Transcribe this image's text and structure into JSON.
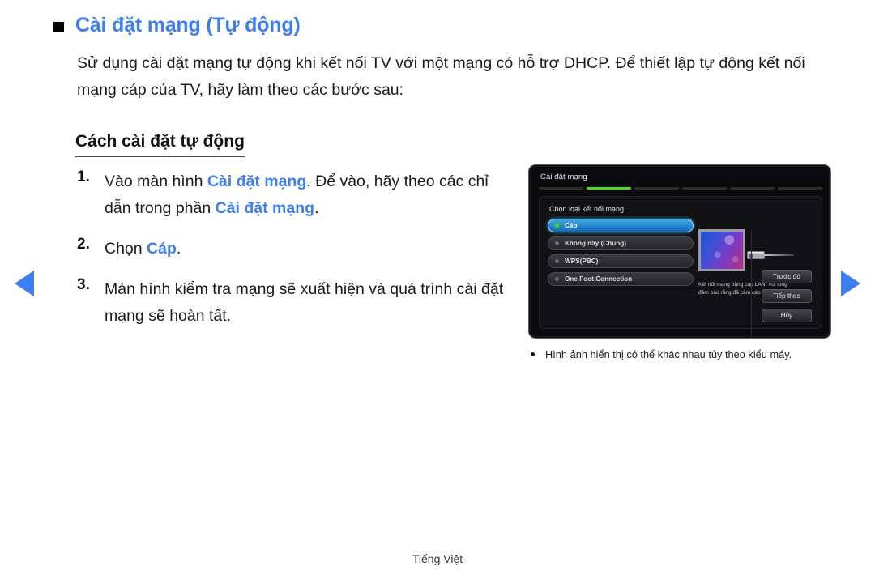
{
  "page": {
    "heading": "Cài đặt mạng (Tự động)",
    "heading_color": "#3d7ff0",
    "intro": "Sử dụng cài đặt mạng tự động khi kết nối TV với một mạng có hỗ trợ DHCP. Để thiết lập tự động kết nối mạng cáp của TV, hãy làm theo các bước sau:",
    "subheading": "Cách cài đặt tự động",
    "footer_language": "Tiếng Việt"
  },
  "nav": {
    "prev_label": "previous-page-arrow",
    "next_label": "next-page-arrow"
  },
  "steps": [
    {
      "number": "1.",
      "parts": [
        {
          "text": "Vào màn hình ",
          "highlight": false
        },
        {
          "text": "Cài đặt mạng",
          "highlight": true
        },
        {
          "text": ". Để vào, hãy theo các chỉ dẫn trong phần ",
          "highlight": false
        },
        {
          "text": "Cài đặt mạng",
          "highlight": true
        },
        {
          "text": ".",
          "highlight": false
        }
      ]
    },
    {
      "number": "2.",
      "parts": [
        {
          "text": "Chọn ",
          "highlight": false
        },
        {
          "text": "Cáp",
          "highlight": true
        },
        {
          "text": ".",
          "highlight": false
        }
      ]
    },
    {
      "number": "3.",
      "parts": [
        {
          "text": "Màn hình kiểm tra mạng sẽ xuất hiện và quá trình cài đặt mạng sẽ hoàn tất.",
          "highlight": false
        }
      ]
    }
  ],
  "tv_screen": {
    "title": "Cài đặt mạng",
    "progress": {
      "total_segments": 6,
      "active_index": 1,
      "active_color": "#4cdb1f"
    },
    "prompt": "Chọn loại kết nối mạng.",
    "options": [
      {
        "label": "Cáp",
        "selected": true,
        "indicator_color": "#35e025"
      },
      {
        "label": "Không dây (Chung)",
        "selected": false,
        "indicator_color": "#6a6c74"
      },
      {
        "label": "WPS(PBC)",
        "selected": false,
        "indicator_color": "#6a6c74"
      },
      {
        "label": "One Foot Connection",
        "selected": false,
        "indicator_color": "#6a6c74"
      }
    ],
    "description": "Kết nối mạng bằng cáp LAN. Vui lòng đảm bảo rằng đã cắm cáp LAN.",
    "actions": [
      {
        "label": "Trước đó"
      },
      {
        "label": "Tiếp theo"
      },
      {
        "label": "Hủy"
      }
    ],
    "illustration": "tv-with-lan-cable-illustration"
  },
  "caption": {
    "note": "Hình ảnh hiển thị có thể khác nhau tùy theo kiểu máy."
  }
}
